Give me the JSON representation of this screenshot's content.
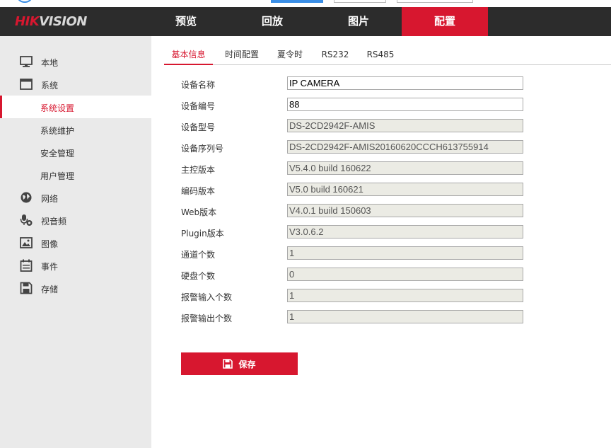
{
  "brand": {
    "part1": "HIK",
    "part2": "VISION"
  },
  "nav": [
    {
      "label": "预览",
      "active": false
    },
    {
      "label": "回放",
      "active": false
    },
    {
      "label": "图片",
      "active": false
    },
    {
      "label": "配置",
      "active": true
    }
  ],
  "sidebar": {
    "local": "本地",
    "system": "系统",
    "system_settings": "系统设置",
    "system_maintenance": "系统维护",
    "security": "安全管理",
    "user_management": "用户管理",
    "network": "网络",
    "video_audio": "视音频",
    "image": "图像",
    "event": "事件",
    "storage": "存储"
  },
  "tabs": {
    "basic_info": "基本信息",
    "time_settings": "时间配置",
    "dst": "夏令时",
    "rs232": "RS232",
    "rs485": "RS485"
  },
  "form": [
    {
      "label": "设备名称",
      "value": "IP CAMERA",
      "editable": true
    },
    {
      "label": "设备编号",
      "value": "88",
      "editable": true
    },
    {
      "label": "设备型号",
      "value": "DS-2CD2942F-AMIS",
      "editable": false
    },
    {
      "label": "设备序列号",
      "value": "DS-2CD2942F-AMIS20160620CCCH613755914",
      "editable": false
    },
    {
      "label": "主控版本",
      "value": "V5.4.0 build 160622",
      "editable": false
    },
    {
      "label": "编码版本",
      "value": "V5.0 build 160621",
      "editable": false
    },
    {
      "label": "Web版本",
      "value": "V4.0.1 build 150603",
      "editable": false
    },
    {
      "label": "Plugin版本",
      "value": "V3.0.6.2",
      "editable": false
    },
    {
      "label": "通道个数",
      "value": "1",
      "editable": false
    },
    {
      "label": "硬盘个数",
      "value": "0",
      "editable": false
    },
    {
      "label": "报警输入个数",
      "value": "1",
      "editable": false
    },
    {
      "label": "报警输出个数",
      "value": "1",
      "editable": false
    }
  ],
  "save_label": "保存",
  "colors": {
    "accent": "#d7172f",
    "header_bg": "#2c2c2c",
    "sidebar_bg": "#eaeaea",
    "readonly_bg": "#ebebe4"
  }
}
